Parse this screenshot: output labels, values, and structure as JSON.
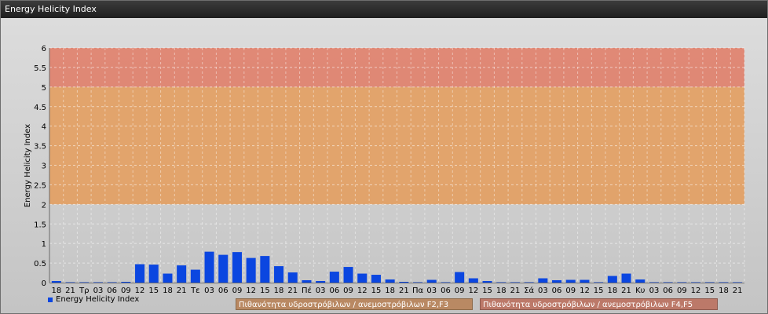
{
  "window": {
    "title": "Energy Helicity Index"
  },
  "chart_data": {
    "type": "bar",
    "title": "",
    "ylabel": "Energy Helicity Index",
    "xlabel": "",
    "ylim": [
      0,
      6
    ],
    "yticks": [
      "0",
      "0.5",
      "1",
      "1.5",
      "2",
      "2.5",
      "3",
      "3.5",
      "4",
      "4.5",
      "5",
      "5.5",
      "6"
    ],
    "categories": [
      "18",
      "21",
      "Τρ",
      "03",
      "06",
      "09",
      "12",
      "15",
      "18",
      "21",
      "Τε",
      "03",
      "06",
      "09",
      "12",
      "15",
      "18",
      "21",
      "Πέ",
      "03",
      "06",
      "09",
      "12",
      "15",
      "18",
      "21",
      "Πα",
      "03",
      "06",
      "09",
      "12",
      "15",
      "18",
      "21",
      "Σά",
      "03",
      "06",
      "09",
      "12",
      "15",
      "18",
      "21",
      "Κυ",
      "03",
      "06",
      "09",
      "12",
      "15",
      "18",
      "21"
    ],
    "series": [
      {
        "name": "Energy Helicity Index",
        "values": [
          0.04,
          0.01,
          0.01,
          0.01,
          0.01,
          0.02,
          0.47,
          0.46,
          0.23,
          0.44,
          0.33,
          0.79,
          0.71,
          0.78,
          0.63,
          0.68,
          0.42,
          0.26,
          0.06,
          0.04,
          0.28,
          0.4,
          0.23,
          0.2,
          0.08,
          0.02,
          0.01,
          0.07,
          0.01,
          0.27,
          0.11,
          0.04,
          0.01,
          0.01,
          0.01,
          0.11,
          0.06,
          0.07,
          0.07,
          0.01,
          0.17,
          0.23,
          0.08,
          0.01,
          0.01,
          0.01,
          0.01,
          0.01,
          0.01,
          0.01
        ],
        "color": "#0b46e0"
      }
    ],
    "bands": [
      {
        "from": 2,
        "to": 5,
        "color": "#e39f61",
        "label": "Πιθανότητα υδροστρόβιλων / ανεμοστρόβιλων F2,F3"
      },
      {
        "from": 5,
        "to": 6,
        "color": "#e07f6a",
        "label": "Πιθανότητα υδροστρόβιλων / ανεμοστρόβιλων F4,F5"
      }
    ],
    "grid": true,
    "legend_position": "bottom-left"
  }
}
